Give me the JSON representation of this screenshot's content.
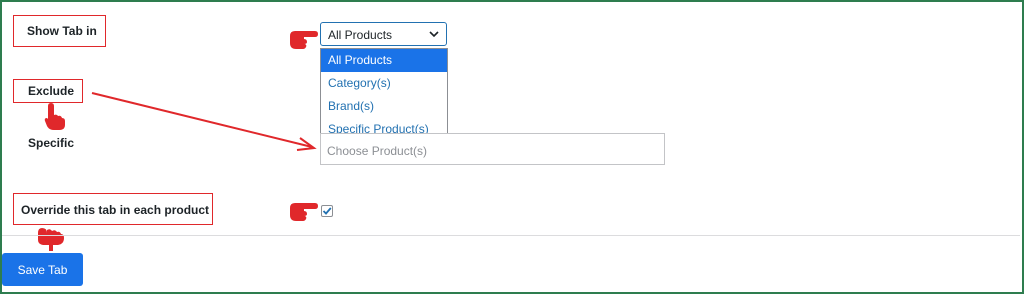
{
  "form": {
    "show_tab_label": "Show Tab in",
    "exclude_label": "Exclude",
    "specific_label": "Specific",
    "override_label": "Override this tab in each product",
    "show_tab_select": {
      "value": "All Products",
      "options": [
        "All Products",
        "Category(s)",
        "Brand(s)",
        "Specific Product(s)"
      ],
      "selected_index": 0
    },
    "specific_input": {
      "placeholder": "Choose Product(s)",
      "value": ""
    },
    "override_checked": true,
    "save_label": "Save Tab"
  },
  "annotations": {
    "highlight_color": "#e0282b",
    "pointer_icon": "pointing-hand-icon",
    "arrow_icon": "arrow-icon"
  },
  "colors": {
    "accent": "#1a73e8",
    "frame": "#2e7d4f"
  }
}
